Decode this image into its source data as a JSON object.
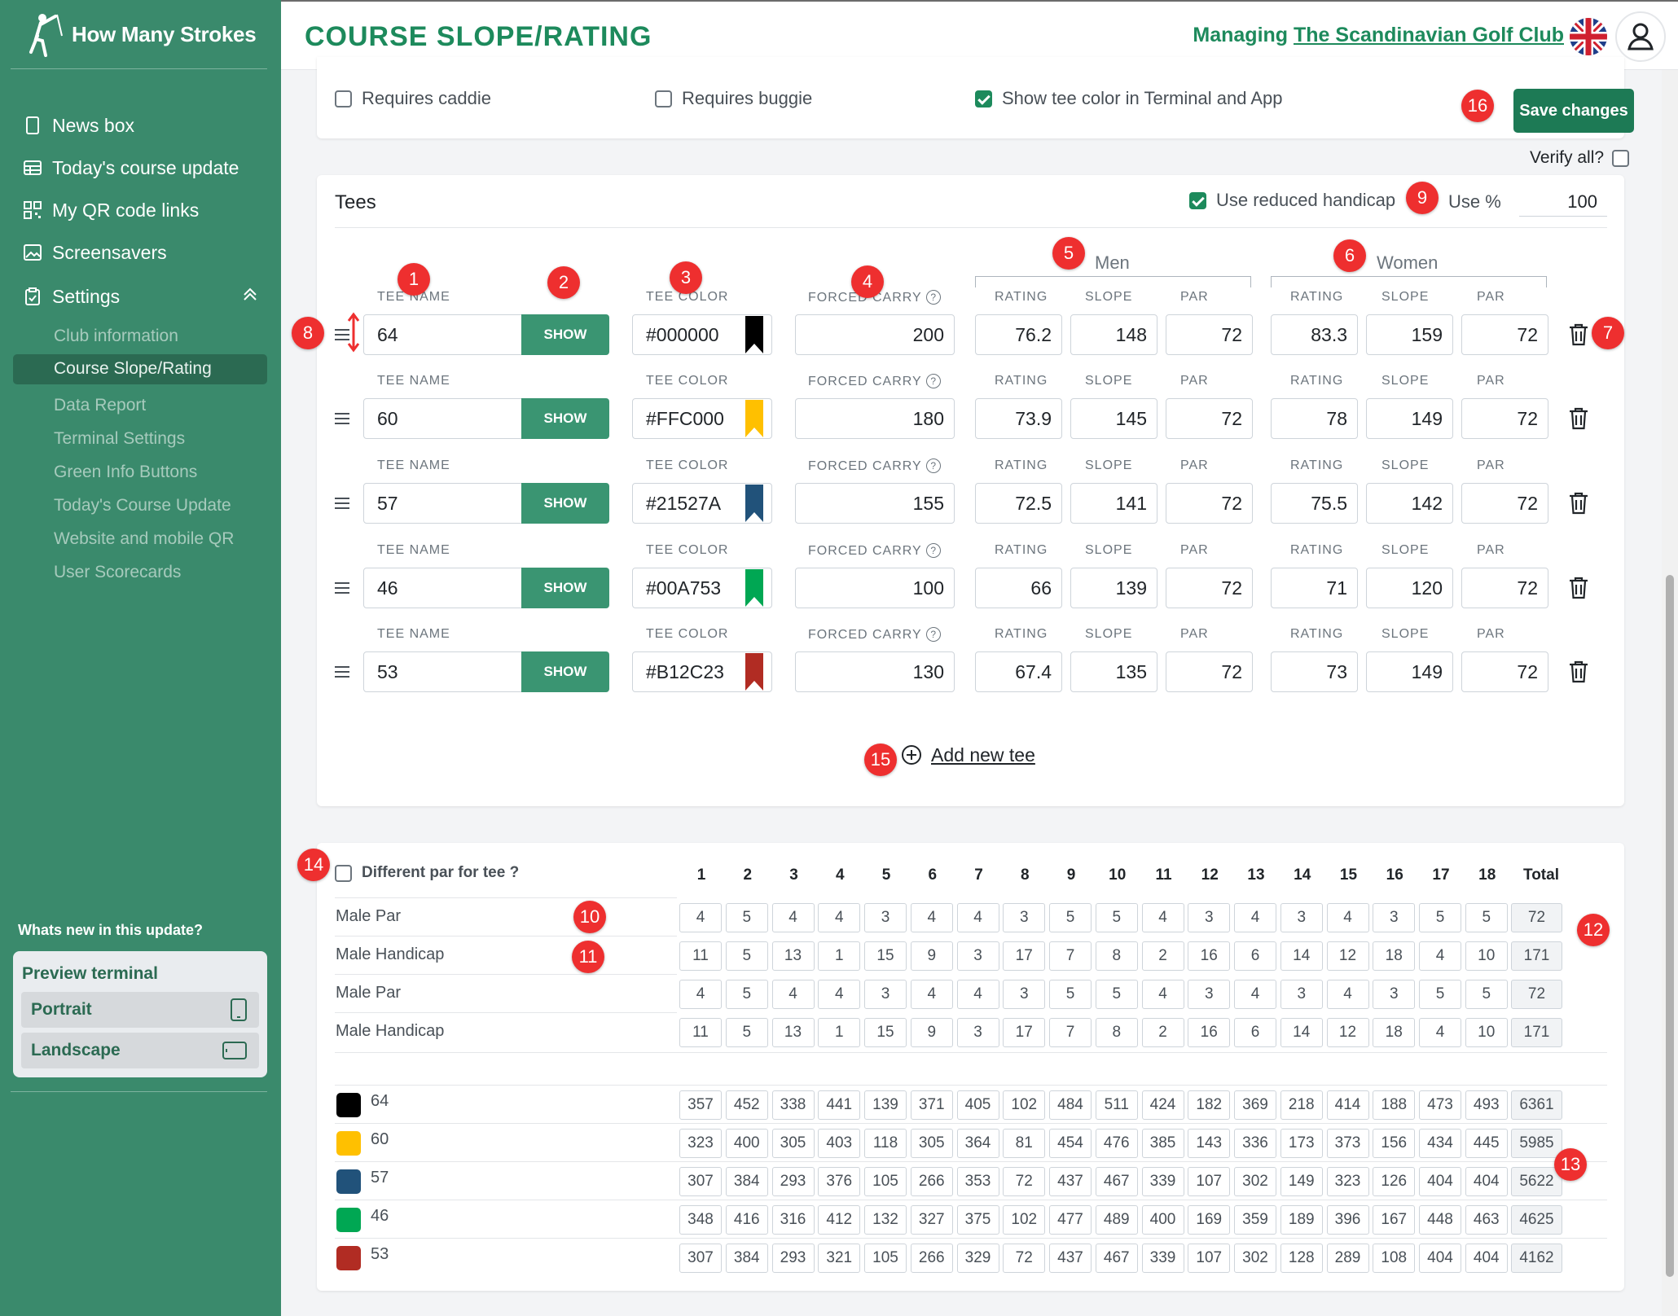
{
  "app": {
    "name": "How Many Strokes",
    "title": "COURSE SLOPE/RATING"
  },
  "header": {
    "managing_label": "Managing",
    "club_name": "The Scandinavian Golf Club"
  },
  "sidebar": {
    "items": [
      {
        "label": "News box",
        "icon": "tablet-icon"
      },
      {
        "label": "Today's course update",
        "icon": "table-icon"
      },
      {
        "label": "My QR code links",
        "icon": "qr-code-icon"
      },
      {
        "label": "Screensavers",
        "icon": "image-icon"
      },
      {
        "label": "Settings",
        "icon": "clipboard-icon"
      }
    ],
    "settings_sub": [
      "Club information",
      "Course Slope/Rating",
      "Data Report",
      "Terminal Settings",
      "Green Info Buttons",
      "Today's Course Update",
      "Website and mobile QR",
      "User Scorecards"
    ],
    "active_sub": "Course Slope/Rating",
    "whats_new": "Whats new in this update?",
    "preview": {
      "title": "Preview terminal",
      "portrait": "Portrait",
      "landscape": "Landscape"
    }
  },
  "options": {
    "caddie": "Requires caddie",
    "caddie_checked": false,
    "buggie": "Requires buggie",
    "buggie_checked": false,
    "show_color": "Show tee color in Terminal and App",
    "show_color_checked": true
  },
  "save_label": "Save changes",
  "verify_label": "Verify all?",
  "tees": {
    "title": "Tees",
    "reduced_label": "Use reduced handicap",
    "reduced_checked": true,
    "use_pct_label": "Use %",
    "use_pct_value": "100",
    "men_label": "Men",
    "women_label": "Women",
    "labels": {
      "tee_name": "TEE NAME",
      "tee_color": "TEE COLOR",
      "forced_carry": "FORCED CARRY",
      "help": "?",
      "rating": "RATING",
      "slope": "SLOPE",
      "par": "PAR",
      "show": "SHOW"
    },
    "rows": [
      {
        "name": "64",
        "color": "#000000",
        "carry": "200",
        "m_rating": "76.2",
        "m_slope": "148",
        "m_par": "72",
        "w_rating": "83.3",
        "w_slope": "159",
        "w_par": "72"
      },
      {
        "name": "60",
        "color": "#FFC000",
        "carry": "180",
        "m_rating": "73.9",
        "m_slope": "145",
        "m_par": "72",
        "w_rating": "78",
        "w_slope": "149",
        "w_par": "72"
      },
      {
        "name": "57",
        "color": "#21527A",
        "carry": "155",
        "m_rating": "72.5",
        "m_slope": "141",
        "m_par": "72",
        "w_rating": "75.5",
        "w_slope": "142",
        "w_par": "72"
      },
      {
        "name": "46",
        "color": "#00A753",
        "carry": "100",
        "m_rating": "66",
        "m_slope": "139",
        "m_par": "72",
        "w_rating": "71",
        "w_slope": "120",
        "w_par": "72"
      },
      {
        "name": "53",
        "color": "#B12C23",
        "carry": "130",
        "m_rating": "67.4",
        "m_slope": "135",
        "m_par": "72",
        "w_rating": "73",
        "w_slope": "149",
        "w_par": "72"
      }
    ],
    "add_label": "Add new tee"
  },
  "scorecard": {
    "diff_par_label": "Different par for tee ?",
    "diff_par_checked": false,
    "holes": [
      "1",
      "2",
      "3",
      "4",
      "5",
      "6",
      "7",
      "8",
      "9",
      "10",
      "11",
      "12",
      "13",
      "14",
      "15",
      "16",
      "17",
      "18"
    ],
    "total_label": "Total",
    "rows": [
      {
        "label": "Male Par",
        "values": [
          "4",
          "5",
          "4",
          "4",
          "3",
          "4",
          "4",
          "3",
          "5",
          "5",
          "4",
          "3",
          "4",
          "3",
          "4",
          "3",
          "5",
          "5"
        ],
        "total": "72"
      },
      {
        "label": "Male Handicap",
        "values": [
          "11",
          "5",
          "13",
          "1",
          "15",
          "9",
          "3",
          "17",
          "7",
          "8",
          "2",
          "16",
          "6",
          "14",
          "12",
          "18",
          "4",
          "10"
        ],
        "total": "171"
      },
      {
        "label": "Male Par",
        "values": [
          "4",
          "5",
          "4",
          "4",
          "3",
          "4",
          "4",
          "3",
          "5",
          "5",
          "4",
          "3",
          "4",
          "3",
          "4",
          "3",
          "5",
          "5"
        ],
        "total": "72"
      },
      {
        "label": "Male Handicap",
        "values": [
          "11",
          "5",
          "13",
          "1",
          "15",
          "9",
          "3",
          "17",
          "7",
          "8",
          "2",
          "16",
          "6",
          "14",
          "12",
          "18",
          "4",
          "10"
        ],
        "total": "171"
      }
    ],
    "distances": [
      {
        "tee": "64",
        "color": "#000000",
        "values": [
          "357",
          "452",
          "338",
          "441",
          "139",
          "371",
          "405",
          "102",
          "484",
          "511",
          "424",
          "182",
          "369",
          "218",
          "414",
          "188",
          "473",
          "493"
        ],
        "total": "6361"
      },
      {
        "tee": "60",
        "color": "#FFC000",
        "values": [
          "323",
          "400",
          "305",
          "403",
          "118",
          "305",
          "364",
          "81",
          "454",
          "476",
          "385",
          "143",
          "336",
          "173",
          "373",
          "156",
          "434",
          "445"
        ],
        "total": "5985"
      },
      {
        "tee": "57",
        "color": "#21527A",
        "values": [
          "307",
          "384",
          "293",
          "376",
          "105",
          "266",
          "353",
          "72",
          "437",
          "467",
          "339",
          "107",
          "302",
          "149",
          "323",
          "126",
          "404",
          "404"
        ],
        "total": "5622"
      },
      {
        "tee": "46",
        "color": "#00A753",
        "values": [
          "348",
          "416",
          "316",
          "412",
          "132",
          "327",
          "375",
          "102",
          "477",
          "489",
          "400",
          "169",
          "359",
          "189",
          "396",
          "167",
          "448",
          "463"
        ],
        "total": "4625"
      },
      {
        "tee": "53",
        "color": "#B12C23",
        "values": [
          "307",
          "384",
          "293",
          "321",
          "105",
          "266",
          "329",
          "72",
          "437",
          "467",
          "339",
          "107",
          "302",
          "128",
          "289",
          "108",
          "404",
          "404"
        ],
        "total": "4162"
      }
    ]
  },
  "badges": [
    "1",
    "2",
    "3",
    "4",
    "5",
    "6",
    "7",
    "8",
    "9",
    "10",
    "11",
    "12",
    "13",
    "14",
    "15",
    "16"
  ],
  "colors": {
    "sidebar": "#3a8a6c",
    "accent": "#1d8a5c",
    "badge": "#ee2f2f"
  }
}
